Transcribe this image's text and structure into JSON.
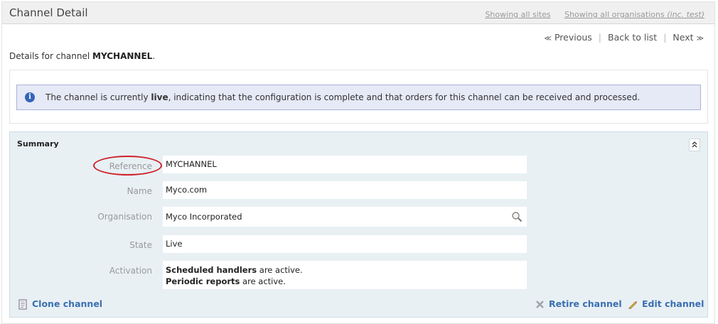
{
  "header": {
    "title": "Channel Detail",
    "site_filter": "Showing all sites",
    "org_filter_prefix": "Showing all organisations",
    "org_filter_suffix": "(inc. test)"
  },
  "pager": {
    "previous": "Previous",
    "back": "Back to list",
    "next": "Next",
    "prev_arrow": "≪",
    "next_arrow": "≫"
  },
  "intro": {
    "prefix": "Details for channel",
    "channel": "MYCHANNEL",
    "suffix": "."
  },
  "notice": {
    "icon": "info-icon",
    "before": "The channel is currently",
    "state_word": "live",
    "after": ", indicating that the configuration is complete and that orders for this channel can be received and processed."
  },
  "summary": {
    "title": "Summary",
    "collapse_icon": "double-chevron-up-icon",
    "fields": {
      "reference": {
        "label": "Reference",
        "value": "MYCHANNEL"
      },
      "name": {
        "label": "Name",
        "value": "Myco.com"
      },
      "organisation": {
        "label": "Organisation",
        "value": "Myco Incorporated"
      },
      "state": {
        "label": "State",
        "value": "Live"
      },
      "activation": {
        "label": "Activation",
        "line1_bold": "Scheduled handlers",
        "line1_rest": "are active.",
        "line2_bold": "Periodic reports",
        "line2_rest": "are active."
      }
    },
    "actions": {
      "clone": "Clone channel",
      "retire": "Retire channel",
      "edit": "Edit channel"
    }
  },
  "colors": {
    "link": "#3a6fb0",
    "notice_bg": "#e6e9f6",
    "summary_bg": "#e8f0f4",
    "highlight_oval": "#d0202a"
  }
}
